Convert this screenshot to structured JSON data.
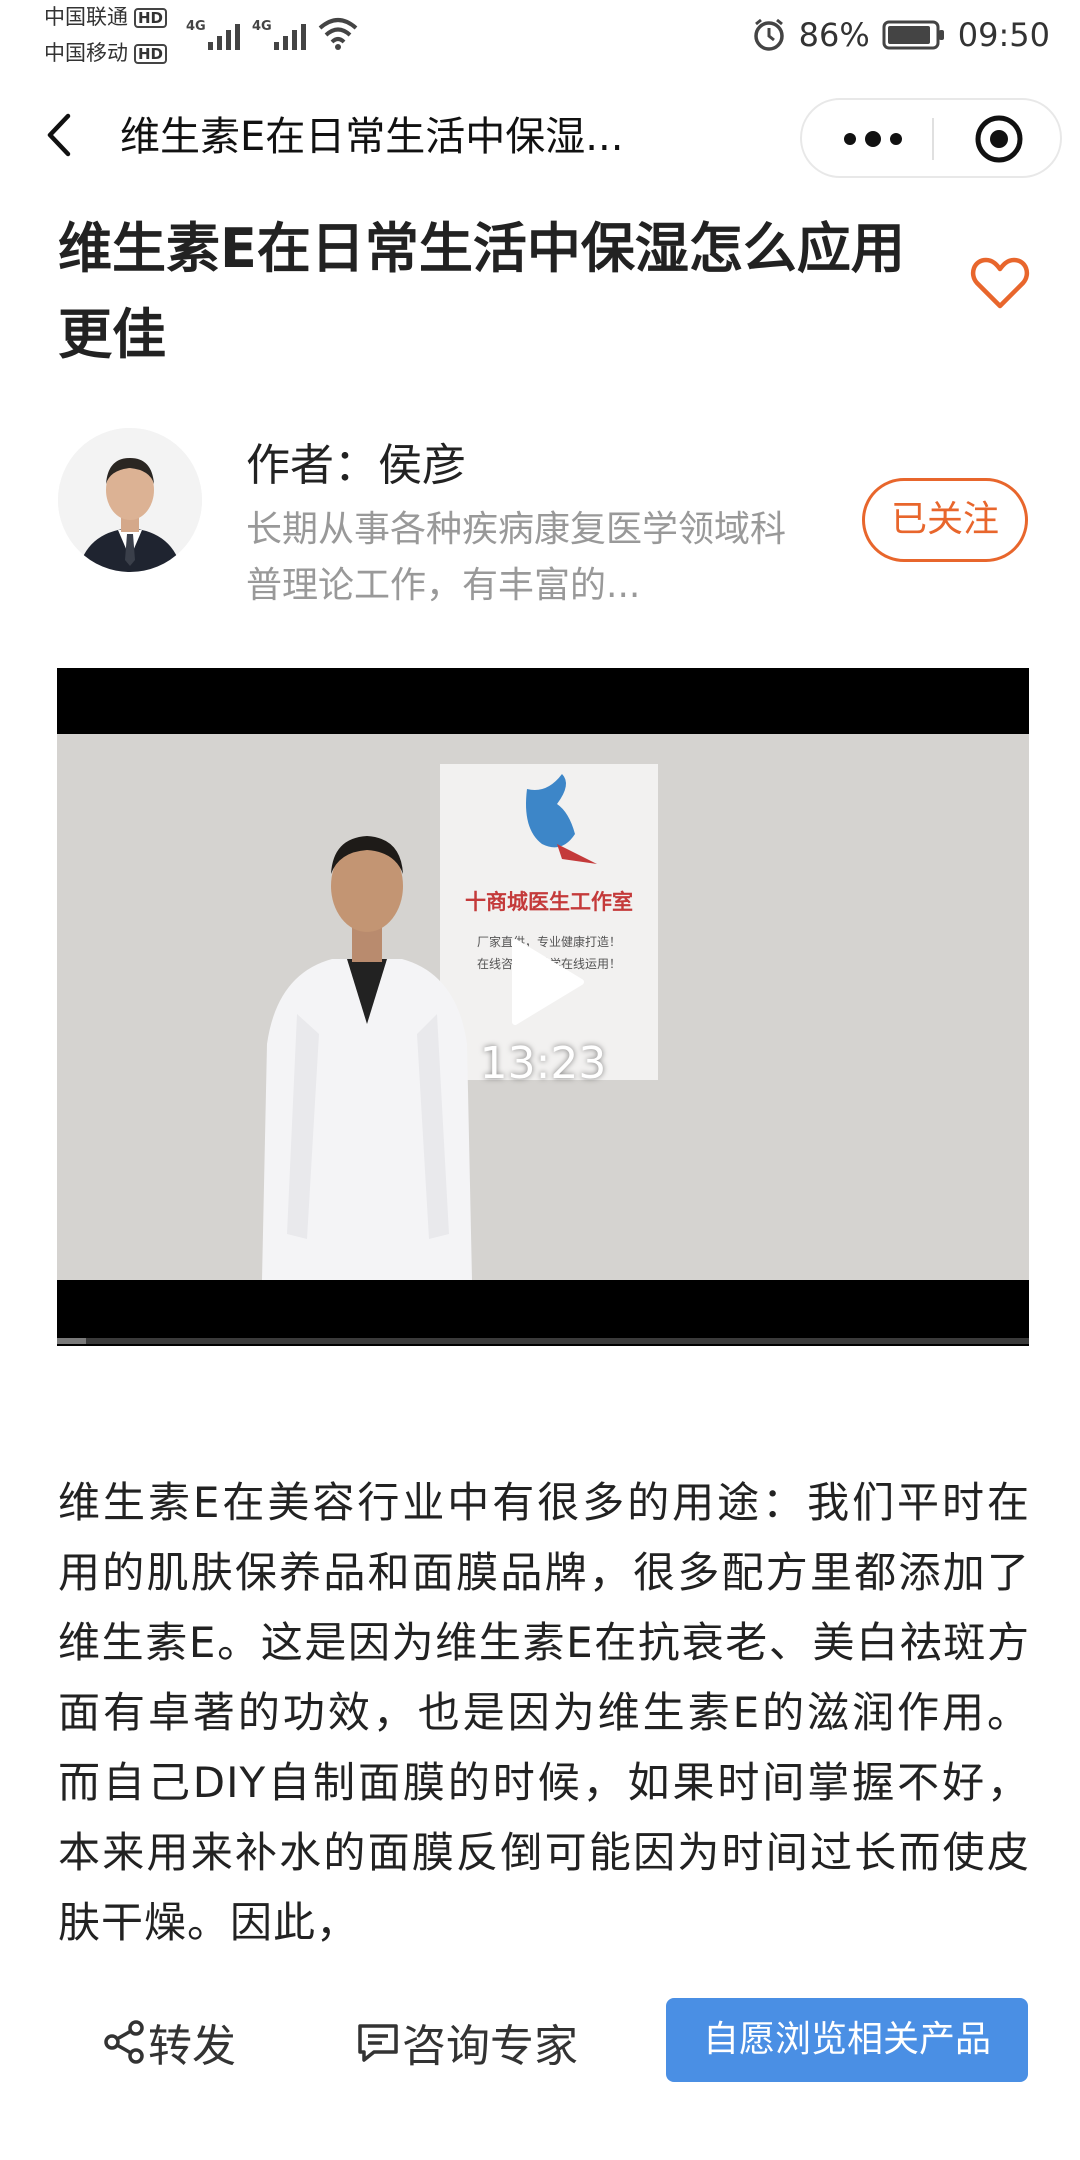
{
  "status_bar": {
    "carrier1": "中国联通",
    "carrier2": "中国移动",
    "hd": "HD",
    "network": "4G",
    "battery": "86%",
    "time": "09:50"
  },
  "nav": {
    "title": "维生素E在日常生活中保湿..."
  },
  "article": {
    "title": "维生素E在日常生活中保湿怎么应用更佳",
    "author_name": "作者：侯彦",
    "author_desc": "长期从事各种疾病康复医学领域科普理论工作，有丰富的...",
    "follow_label": "已关注",
    "video_duration": "13:23",
    "video_progress": 0.03,
    "body": "维生素E在美容行业中有很多的用途：我们平时在用的肌肤保养品和面膜品牌，很多配方里都添加了维生素E。这是因为维生素E在抗衰老、美白祛斑方面有卓著的功效，也是因为维生素E的滋润作用。而自己DIY自制面膜的时候，如果时间掌握不好，本来用来补水的面膜反倒可能因为时间过长而使皮肤干燥。因此，"
  },
  "video_scene": {
    "poster_title": "十商城医生工作室",
    "poster_line1": "厂家直供，专业健康打造！",
    "poster_line2": "在线咨询，科学在线运用！"
  },
  "bottom_bar": {
    "share_label": "转发",
    "consult_label": "咨询专家",
    "cta_label": "自愿浏览相关产品"
  },
  "colors": {
    "accent": "#e8662c",
    "cta": "#4a8fe4"
  }
}
